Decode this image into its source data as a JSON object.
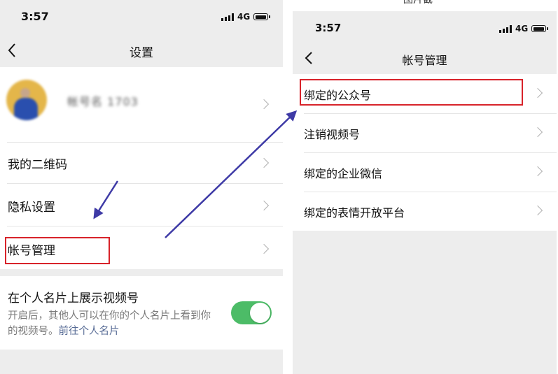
{
  "left": {
    "status": {
      "time": "3:57",
      "network": "4G"
    },
    "nav": {
      "title": "设置"
    },
    "profile": {
      "name": "帐号名 1703"
    },
    "items": [
      {
        "label": "我的二维码"
      },
      {
        "label": "隐私设置"
      },
      {
        "label": "帐号管理"
      }
    ],
    "channel_card": {
      "title": "在个人名片上展示视频号",
      "description": "开启后，其他人可以在你的个人名片上看到你的视频号。",
      "link": "前往个人名片",
      "toggle_on": true
    }
  },
  "right": {
    "status": {
      "time": "3:57",
      "network": "4G"
    },
    "nav": {
      "title": "帐号管理"
    },
    "items": [
      {
        "label": "绑定的公众号"
      },
      {
        "label": "注销视频号"
      },
      {
        "label": "绑定的企业微信"
      },
      {
        "label": "绑定的表情开放平台"
      }
    ]
  },
  "top_cut_text": "图片截",
  "colors": {
    "background": "#ededed",
    "card": "#ffffff",
    "toggle": "#4cbc67",
    "highlight_box": "#d8232a",
    "annotation_arrow": "#3e3aa6",
    "link": "#576b95"
  }
}
